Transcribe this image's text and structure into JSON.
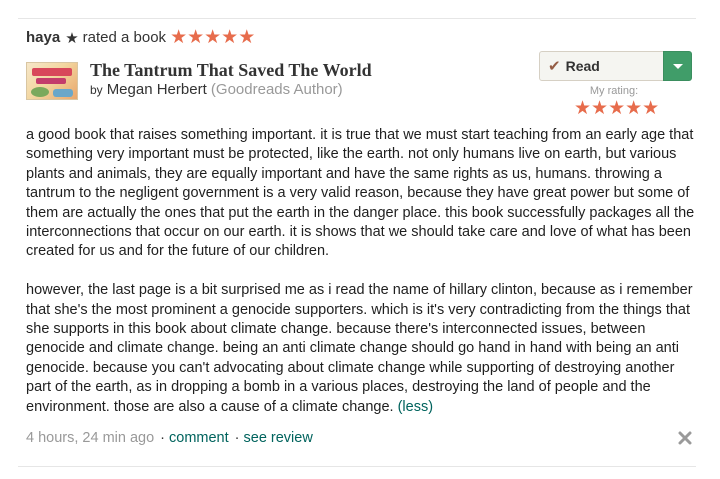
{
  "activity": {
    "user_name": "haya",
    "star_glyph": "★",
    "action_text": "rated a book",
    "rating_stars": "★★★★★"
  },
  "book": {
    "cover_icon": "book-cover-image",
    "title": "The Tantrum That Saved The World",
    "by_label": "by",
    "author": "Megan Herbert",
    "author_note": "(Goodreads Author)"
  },
  "shelf": {
    "check_glyph": "✔",
    "label": "Read",
    "dropdown_icon": "caret-down-icon",
    "accent_color": "#409d69"
  },
  "my_rating": {
    "label": "My rating:",
    "stars": "★★★★★",
    "value": 5,
    "max": 5,
    "star_color": "#e76c4c"
  },
  "review": {
    "paragraph_1": "a good book that raises something important. it is true that we must start teaching from an early age that something very important must be protected, like the earth. not only humans live on earth, but various plants and animals, they are equally important and have the same rights as us, humans. throwing a tantrum to the negligent government is a very valid reason, because they have great power but some of them are actually the ones that put the earth in the danger place. this book successfully packages all the interconnections that occur on our earth. it is shows that we should take care and love of what has been created for us and for the future of our children.",
    "paragraph_2": "however, the last page is a bit surprised me as i read the name of hillary clinton, because as i remember that she's the most prominent a genocide supporters. which is it's very contradicting from the things that she supports in this book about climate change. because there's interconnected issues, between genocide and climate change. being an anti climate change should go hand in hand with being an anti genocide. because you can't advocating about climate change while supporting of destroying another part of the earth, as in dropping a bomb in a various places, destroying the land of people and the environment. those are also a cause of a climate change.",
    "less_link": "(less)"
  },
  "footer": {
    "timestamp": "4 hours, 24 min ago",
    "separator": "·",
    "comment_link": "comment",
    "see_review_link": "see review",
    "close_icon": "close-icon"
  }
}
